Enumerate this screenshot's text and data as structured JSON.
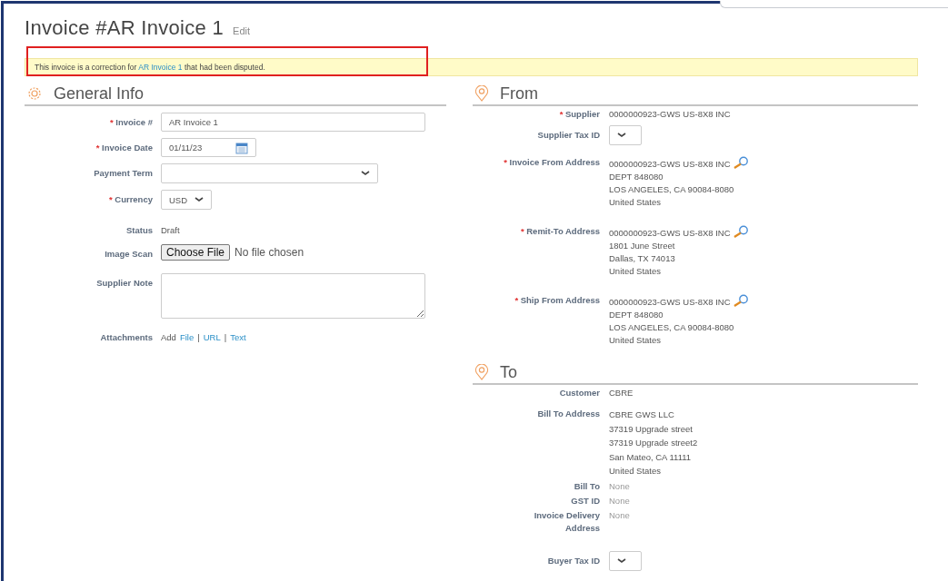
{
  "title": "Invoice #AR Invoice 1",
  "edit_link": "Edit",
  "notice": {
    "text_before": "This invoice is a correction for",
    "link": "AR Invoice 1",
    "text_after": "that had been disputed.",
    "highlighted": true
  },
  "general_info": {
    "heading": "General Info",
    "fields": [
      {
        "kind": "input",
        "marker": "*",
        "label": "Invoice #",
        "value": "AR Invoice 1"
      },
      {
        "kind": "date",
        "marker": "*",
        "label": "Invoice Date",
        "value": "01/11/23"
      },
      {
        "kind": "dropdown",
        "label": "Payment Term"
      },
      {
        "kind": "compact-dropdown",
        "marker": "*",
        "label": "Currency",
        "value": "USD"
      },
      {
        "kind": "text",
        "label": "Status",
        "lines": [
          "Draft"
        ]
      },
      {
        "kind": "file",
        "label": "Image Scan",
        "button": "Choose File",
        "value": "No file chosen"
      },
      {
        "kind": "textarea",
        "label": "Supplier Note"
      },
      {
        "kind": "links",
        "label": "Attachments",
        "prefix": "Add",
        "separator": "|",
        "links": [
          "File",
          "URL",
          "Text"
        ]
      }
    ]
  },
  "from": {
    "heading": "From",
    "fields": [
      {
        "kind": "text",
        "marker": "*",
        "label": "Supplier",
        "lines": [
          "0000000923-GWS US-8X8 INC"
        ]
      },
      {
        "kind": "compact-dropdown",
        "label": "Supplier Tax ID"
      },
      {
        "kind": "address",
        "marker": "*",
        "label": "Invoice From Address",
        "lookup": true,
        "lines": [
          "0000000923-GWS US-8X8 INC",
          "DEPT 848080",
          "LOS ANGELES, CA 90084-8080",
          "United States"
        ]
      },
      {
        "kind": "address",
        "marker": "*",
        "label": "Remit-To Address",
        "lookup": true,
        "lines": [
          "0000000923-GWS US-8X8 INC",
          "1801 June Street",
          "Dallas, TX 74013",
          "United States"
        ]
      },
      {
        "kind": "address",
        "marker": "*",
        "label": "Ship From Address",
        "lookup": true,
        "lines": [
          "0000000923-GWS US-8X8 INC",
          "DEPT 848080",
          "LOS ANGELES, CA 90084-8080",
          "United States"
        ]
      }
    ]
  },
  "to": {
    "heading": "To",
    "fields": [
      {
        "kind": "text",
        "label": "Customer",
        "lines": [
          "CBRE"
        ]
      },
      {
        "kind": "address",
        "label": "Bill To Address",
        "lines": [
          "CBRE GWS LLC",
          "37319 Upgrade street",
          "37319 Upgrade street2",
          "San Mateo, CA 11111",
          "United States"
        ]
      },
      {
        "kind": "empty",
        "label": "Bill To",
        "lines": [
          "None"
        ]
      },
      {
        "kind": "empty",
        "label": "GST ID",
        "lines": [
          "None"
        ]
      },
      {
        "kind": "empty",
        "label": "Invoice Delivery Address",
        "lines": [
          "None"
        ]
      },
      {
        "kind": "compact-dropdown",
        "label": "Buyer Tax ID"
      }
    ]
  }
}
